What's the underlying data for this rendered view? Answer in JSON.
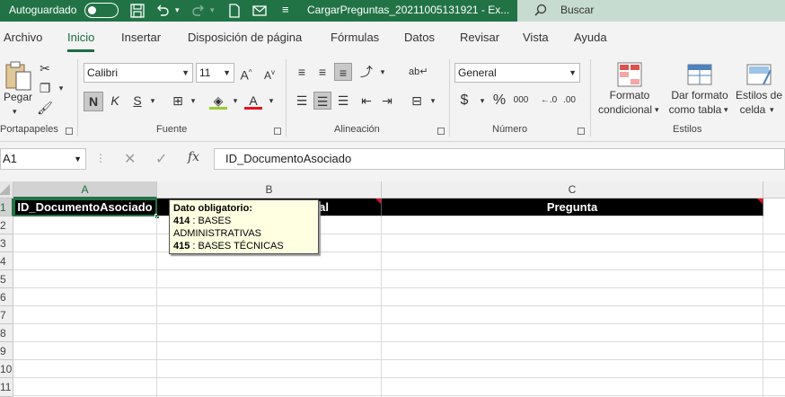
{
  "titlebar": {
    "autosave_label": "Autoguardado",
    "autosave_state": "off",
    "filename": "CargarPreguntas_20211005131921  -  Ex...",
    "search_label": "Buscar",
    "bg_color": "#217346"
  },
  "tabs": [
    {
      "label": "Archivo"
    },
    {
      "label": "Inicio",
      "active": true
    },
    {
      "label": "Insertar"
    },
    {
      "label": "Disposición de página"
    },
    {
      "label": "Fórmulas"
    },
    {
      "label": "Datos"
    },
    {
      "label": "Revisar"
    },
    {
      "label": "Vista"
    },
    {
      "label": "Ayuda"
    }
  ],
  "ribbon": {
    "clipboard": {
      "paste_label": "Pegar",
      "group_label": "Portapapeles"
    },
    "font": {
      "font_name": "Calibri",
      "font_size": "11",
      "bold": "N",
      "italic": "K",
      "underline": "S",
      "group_label": "Fuente"
    },
    "alignment": {
      "group_label": "Alineación"
    },
    "number": {
      "format": "General",
      "currency": "$",
      "percent": "%",
      "thousands": "000",
      "group_label": "Número"
    },
    "styles": {
      "conditional_format": [
        "Formato",
        "condicional"
      ],
      "format_as_table": [
        "Dar formato",
        "como tabla"
      ],
      "cell_styles": [
        "Estilos de",
        "celda"
      ],
      "group_label": "Estilos"
    }
  },
  "formula_bar": {
    "name_box": "A1",
    "fx_label": "fx",
    "content": "ID_DocumentoAsociado"
  },
  "grid": {
    "columns": [
      "A",
      "B",
      "C"
    ],
    "selected_column": "A",
    "rows": [
      "1",
      "2",
      "3",
      "4",
      "5",
      "6",
      "7",
      "8",
      "9",
      "10",
      "11"
    ],
    "selected_row": "1",
    "header_row": {
      "A": "ID_DocumentoAsociado",
      "B": "al",
      "C": "Pregunta"
    }
  },
  "tooltip": {
    "title": "Dato obligatorio:",
    "lines": [
      {
        "code": "414",
        "text": " : BASES ADMINISTRATIVAS"
      },
      {
        "code": "415",
        "text": " : BASES TÉCNICAS"
      }
    ]
  }
}
